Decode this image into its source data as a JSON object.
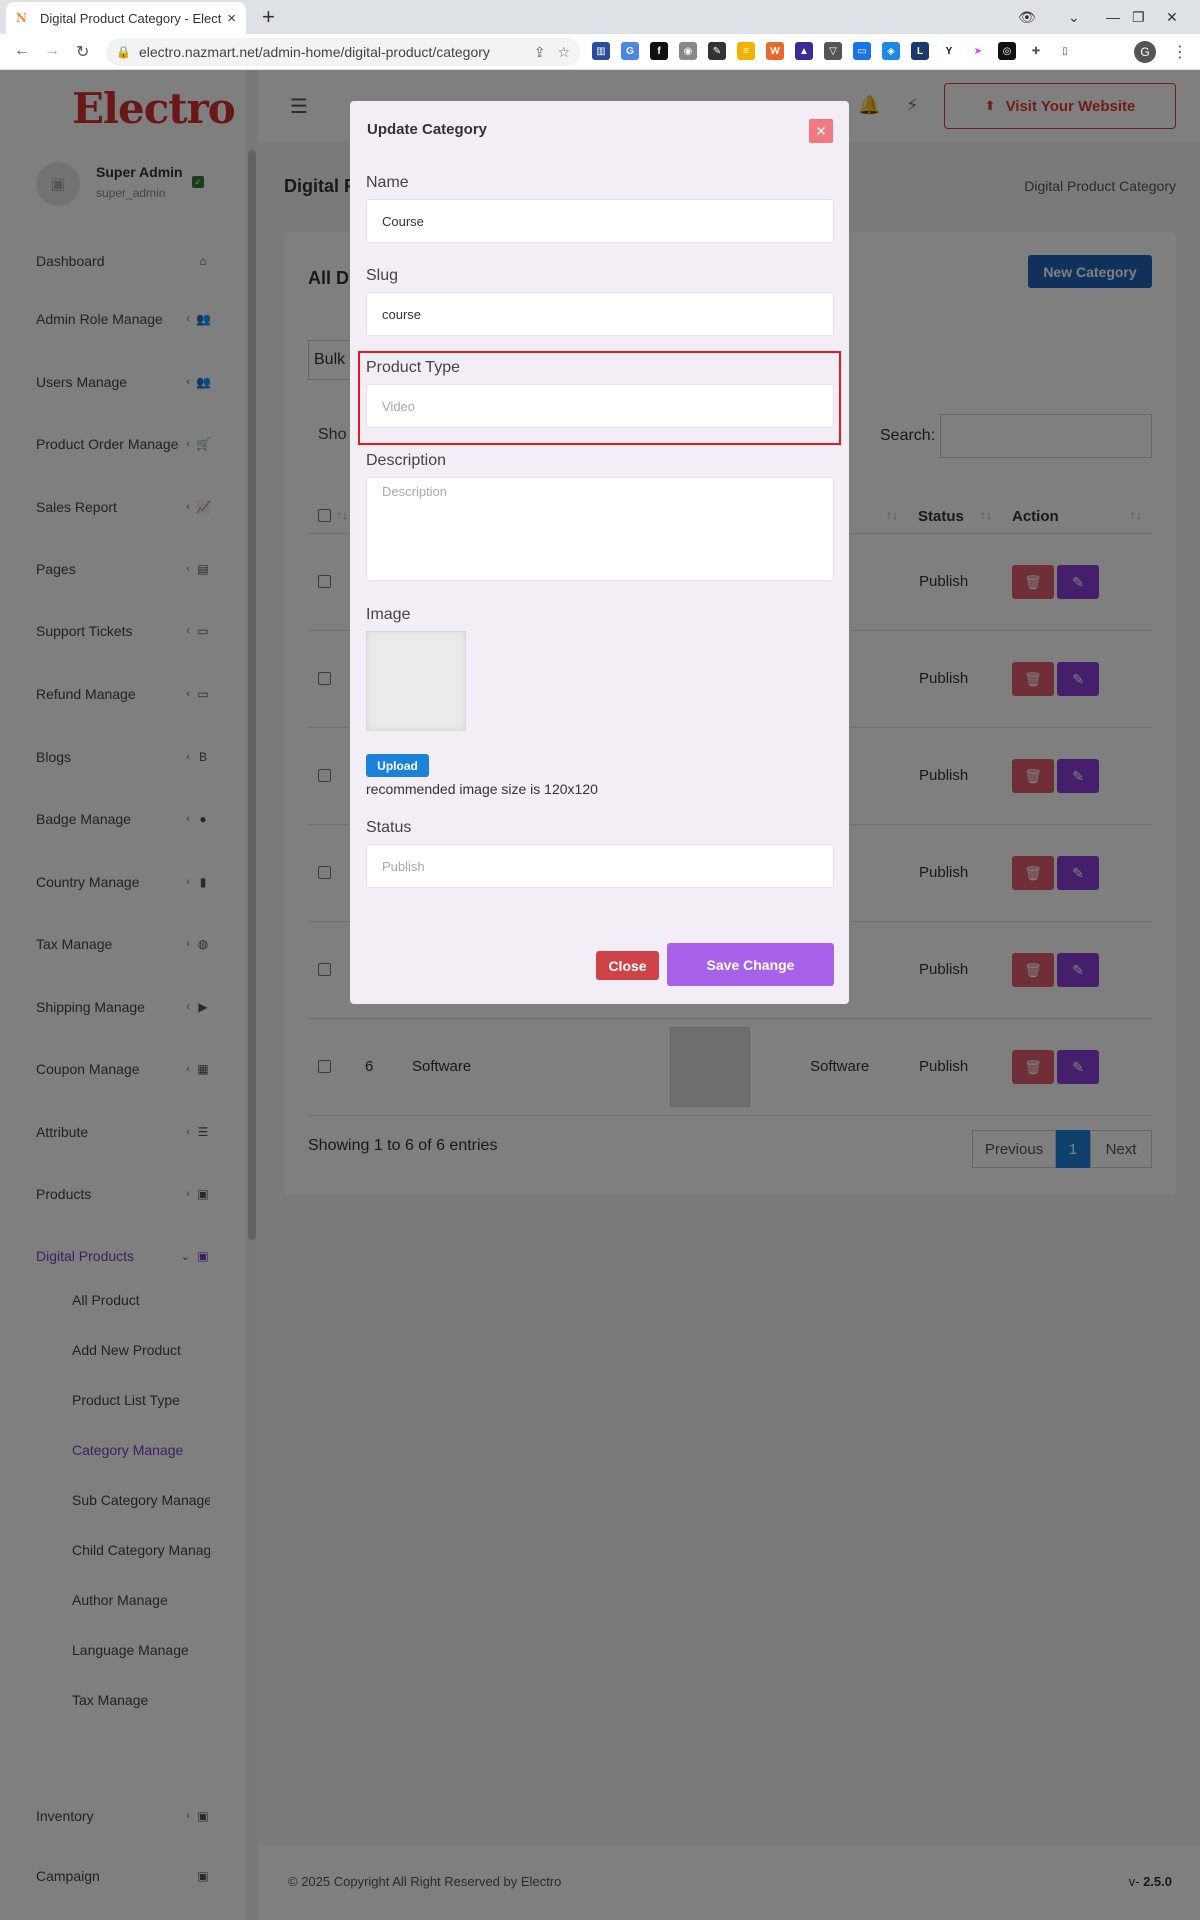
{
  "browser": {
    "tab_title": "Digital Product Category - Electro",
    "url": "electro.nazmart.net/admin-home/digital-product/category",
    "profile_initial": "G"
  },
  "sidebar": {
    "logo": "Electro",
    "user": {
      "name": "Super Admin",
      "handle": "super_admin"
    },
    "items": [
      {
        "label": "Dashboard",
        "icon": "home-icon"
      },
      {
        "label": "Admin Role Manage",
        "icon": "users-icon"
      },
      {
        "label": "Users Manage",
        "icon": "users-icon"
      },
      {
        "label": "Product Order Manage",
        "icon": "cart-icon"
      },
      {
        "label": "Sales Report",
        "icon": "chart-icon"
      },
      {
        "label": "Pages",
        "icon": "file-icon"
      },
      {
        "label": "Support Tickets",
        "icon": "folder-icon"
      },
      {
        "label": "Refund Manage",
        "icon": "folder-icon"
      },
      {
        "label": "Blogs",
        "icon": "blog-icon"
      },
      {
        "label": "Badge Manage",
        "icon": "tag-icon"
      },
      {
        "label": "Country Manage",
        "icon": "map-icon"
      },
      {
        "label": "Tax Manage",
        "icon": "money-icon"
      },
      {
        "label": "Shipping Manage",
        "icon": "truck-icon"
      },
      {
        "label": "Coupon Manage",
        "icon": "ticket-icon"
      },
      {
        "label": "Attribute",
        "icon": "list-icon"
      },
      {
        "label": "Products",
        "icon": "bag-icon"
      },
      {
        "label": "Digital Products",
        "icon": "bag-icon"
      }
    ],
    "sub_items": [
      "All Product",
      "Add New Product",
      "Product List Type",
      "Category Manage",
      "Sub Category Manage",
      "Child Category Manage",
      "Author Manage",
      "Language Manage",
      "Tax Manage"
    ],
    "bottom_items": [
      {
        "label": "Inventory",
        "icon": "bag-icon"
      },
      {
        "label": "Campaign",
        "icon": "bag-icon"
      }
    ]
  },
  "header": {
    "visit_label": "Visit Your Website"
  },
  "page": {
    "title": "Digital P",
    "breadcrumb": "Digital Product Category",
    "card_title": "All D",
    "new_button": "New Category",
    "bulk_label": "Bulk",
    "show_label": "Sho",
    "search_label": "Search:",
    "columns": {
      "status": "Status",
      "action": "Action"
    },
    "rows": [
      {
        "id": "",
        "name": "",
        "type": "",
        "status": "Publish"
      },
      {
        "id": "",
        "name": "",
        "type": "",
        "status": "Publish"
      },
      {
        "id": "",
        "name": "",
        "type": "",
        "status": "Publish"
      },
      {
        "id": "",
        "name": "",
        "type": "",
        "status": "Publish"
      },
      {
        "id": "",
        "name": "",
        "type": "",
        "status": "Publish"
      },
      {
        "id": "6",
        "name": "Software",
        "type": "Software",
        "status": "Publish"
      }
    ],
    "info": "Showing 1 to 6 of 6 entries",
    "pager": {
      "prev": "Previous",
      "current": "1",
      "next": "Next"
    }
  },
  "footer": {
    "copyright": "© 2025 Copyright All Right Reserved by Electro",
    "version_prefix": "v-",
    "version": "2.5.0"
  },
  "modal": {
    "title": "Update Category",
    "name_label": "Name",
    "name_value": "Course",
    "slug_label": "Slug",
    "slug_value": "course",
    "type_label": "Product Type",
    "type_value": "Video",
    "desc_label": "Description",
    "desc_placeholder": "Description",
    "image_label": "Image",
    "upload_label": "Upload",
    "image_hint": "recommended image size is 120x120",
    "status_label": "Status",
    "status_value": "Publish",
    "close_label": "Close",
    "save_label": "Save Change"
  },
  "colors": {
    "accent": "#7b3fc4",
    "danger": "#e53935",
    "primary": "#1e63b7",
    "highlight": "#e01b1b"
  }
}
